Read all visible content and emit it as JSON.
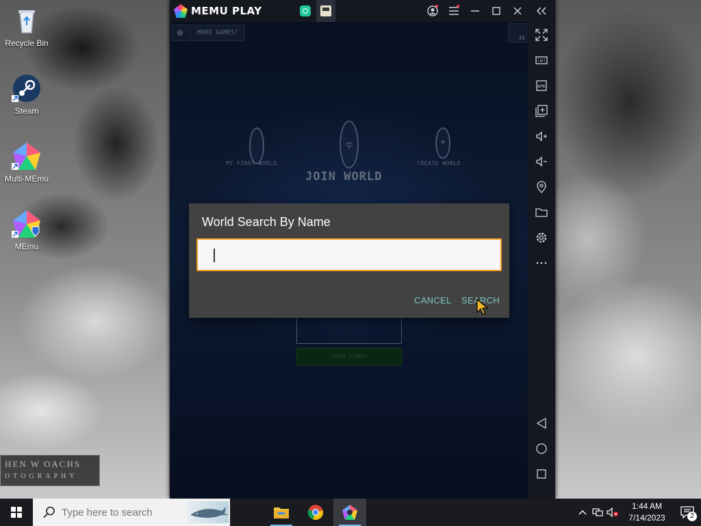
{
  "desktop": {
    "icons": [
      {
        "label": "Recycle Bin",
        "icon": "recycle-bin-icon"
      },
      {
        "label": "Steam",
        "icon": "steam-icon"
      },
      {
        "label": "Multi-MEmu",
        "icon": "multi-memu-icon"
      },
      {
        "label": "MEmu",
        "icon": "memu-icon"
      }
    ],
    "watermark": {
      "line1": "HEN W OACHS",
      "line2": "OTOGRAPHY"
    }
  },
  "emulator": {
    "title": "MEMU PLAY",
    "tabs": [
      {
        "icon": "home-tab-icon"
      },
      {
        "icon": "game-tab-icon",
        "active": true
      }
    ],
    "sidebar": [
      "fullscreen-icon",
      "keyboard-icon",
      "apk-icon",
      "add-app-icon",
      "volume-up-icon",
      "volume-down-icon",
      "location-icon",
      "folder-icon",
      "settings-icon",
      "more-icon"
    ],
    "nav": [
      "back-icon",
      "home-icon",
      "recents-icon"
    ],
    "accent": "#f39a1e"
  },
  "game": {
    "more_games": "MORE GAMES!",
    "badge": "40",
    "my_first_world": "MY FIRST WORLD",
    "create_world": "CREATE WORLD",
    "join_world": "JOIN WORLD",
    "join_lobby": "JOIN LOBBY"
  },
  "dialog": {
    "title": "World Search By Name",
    "input_value": "",
    "cancel": "CANCEL",
    "search": "SEARCH",
    "button_color": "#7fc5c4"
  },
  "taskbar": {
    "search_placeholder": "Type here to search",
    "apps": [
      "file-explorer-icon",
      "chrome-icon",
      "memu-taskbar-icon"
    ],
    "time": "1:44 AM",
    "date": "7/14/2023",
    "notifications": "2"
  }
}
